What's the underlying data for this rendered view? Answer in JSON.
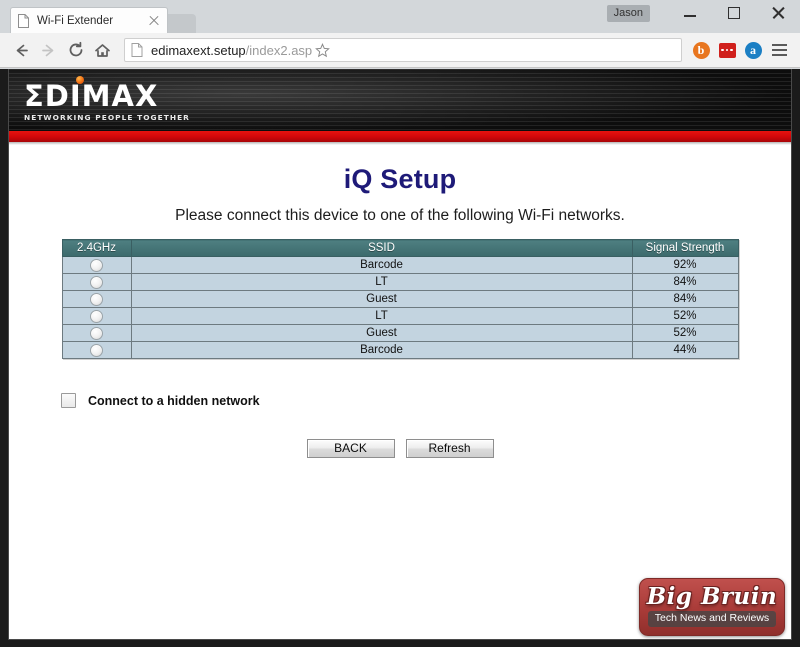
{
  "browser": {
    "tab": {
      "title": "Wi-Fi Extender",
      "favicon_icon": "page-icon",
      "close_icon": "close-icon"
    },
    "newtab_icon": "new-tab-icon",
    "user_badge": "Jason",
    "window_controls": {
      "minimize_icon": "minimize-icon",
      "maximize_icon": "maximize-icon",
      "close_icon": "window-close-icon"
    },
    "toolbar": {
      "back_icon": "back-arrow-icon",
      "forward_icon": "forward-arrow-icon",
      "reload_icon": "reload-icon",
      "home_icon": "home-icon",
      "page_icon": "page-icon",
      "url_host": "edimaxext.setup",
      "url_path": "/index2.asp",
      "bookmark_icon": "star-icon",
      "extensions": [
        {
          "name": "bitly-extension-icon",
          "glyph": "b",
          "color": "#e8761f",
          "shape": "circle"
        },
        {
          "name": "red-dots-extension-icon",
          "glyph": "•••",
          "color": "#d0201c",
          "shape": "square"
        },
        {
          "name": "alexa-extension-icon",
          "glyph": "a",
          "color": "#1b7fc4",
          "shape": "circle"
        }
      ],
      "menu_icon": "hamburger-menu-icon"
    }
  },
  "brand": {
    "logo_text": "ΣDIMAX",
    "tagline": "NETWORKING PEOPLE TOGETHER",
    "dot_icon": "logo-dot-icon",
    "accent_red": "#d1070a",
    "header_black": "#090909"
  },
  "page": {
    "title": "iQ Setup",
    "title_color": "#1e1a78",
    "subtitle": "Please connect this device to one of the following Wi-Fi networks.",
    "table": {
      "header_color": "#3c6a6c",
      "cell_color": "#c3d4e0",
      "columns": [
        "2.4GHz",
        "SSID",
        "Signal Strength"
      ],
      "rows": [
        {
          "selected": false,
          "ssid": "Barcode",
          "signal": "92%"
        },
        {
          "selected": false,
          "ssid": "LT",
          "signal": "84%"
        },
        {
          "selected": false,
          "ssid": "Guest",
          "signal": "84%"
        },
        {
          "selected": false,
          "ssid": "LT",
          "signal": "52%"
        },
        {
          "selected": false,
          "ssid": "Guest",
          "signal": "52%"
        },
        {
          "selected": false,
          "ssid": "Barcode",
          "signal": "44%"
        }
      ]
    },
    "hidden_network": {
      "label": "Connect to a hidden network",
      "checked": false
    },
    "buttons": {
      "back": "BACK",
      "refresh": "Refresh"
    }
  },
  "watermark": {
    "name": "Big Bruin",
    "tagline": "Tech News and Reviews",
    "color": "#a93b38"
  }
}
